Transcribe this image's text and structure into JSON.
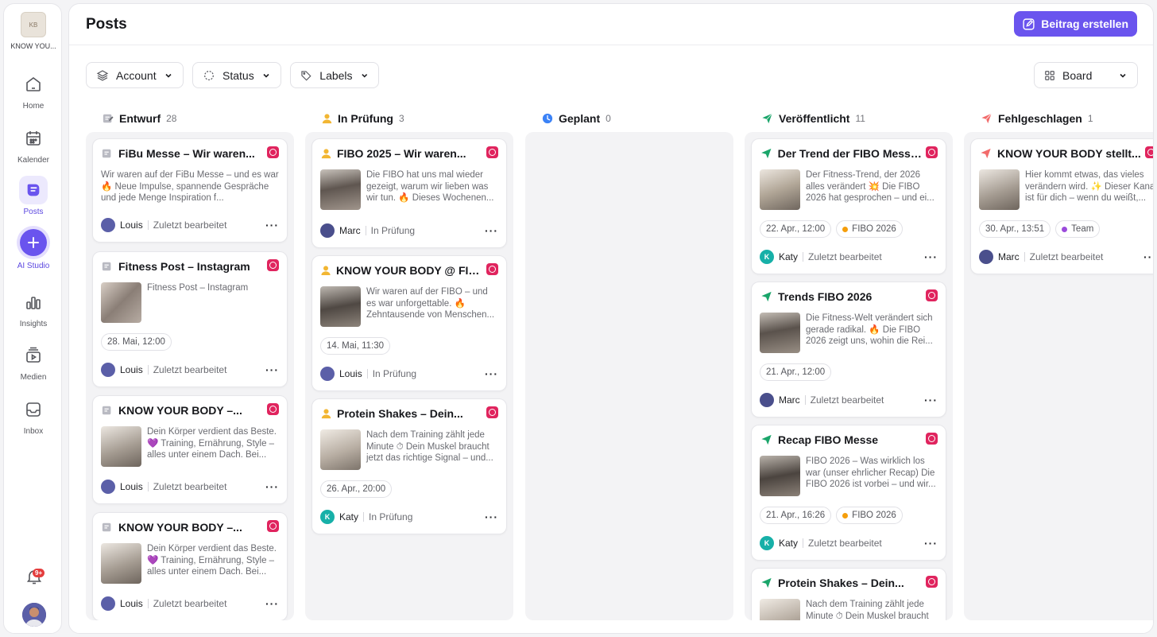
{
  "brand": {
    "name": "KNOW YOU...",
    "logo_text": "KB"
  },
  "nav": [
    {
      "label": "Home"
    },
    {
      "label": "Kalender"
    },
    {
      "label": "Posts"
    },
    {
      "label": "AI Studio"
    },
    {
      "label": "Insights"
    },
    {
      "label": "Medien"
    },
    {
      "label": "Inbox"
    }
  ],
  "notifications": {
    "badge": "9+"
  },
  "header": {
    "title": "Posts",
    "create_label": "Beitrag erstellen"
  },
  "filters": {
    "account": "Account",
    "status": "Status",
    "labels": "Labels",
    "view": "Board"
  },
  "colors": {
    "accent": "#6a54ee",
    "instagram": "#e0245e",
    "label_fibo": "#f59e0b",
    "label_team": "#9b4bdb"
  },
  "columns": [
    {
      "title": "Entwurf",
      "count": "28",
      "cards": [
        {
          "title": "FiBu Messe – Wir waren...",
          "text": "Wir waren auf der FiBu Messe – und es war 🔥 Neue Impulse, spannende Gespräche und jede Menge Inspiration f...",
          "user": "Louis",
          "status": "Zuletzt bearbeitet"
        },
        {
          "title": "Fitness Post – Instagram",
          "text": "Fitness Post – Instagram",
          "date": "28. Mai, 12:00",
          "user": "Louis",
          "status": "Zuletzt bearbeitet"
        },
        {
          "title": "KNOW YOUR BODY –...",
          "text": "Dein Körper verdient das Beste. 💜 Training, Ernährung, Style – alles unter einem Dach. Bei...",
          "user": "Louis",
          "status": "Zuletzt bearbeitet"
        },
        {
          "title": "KNOW YOUR BODY –...",
          "text": "Dein Körper verdient das Beste. 💜 Training, Ernährung, Style – alles unter einem Dach. Bei...",
          "user": "Louis",
          "status": "Zuletzt bearbeitet"
        }
      ]
    },
    {
      "title": "In Prüfung",
      "count": "3",
      "cards": [
        {
          "title": "FIBO 2025 – Wir waren...",
          "text": "Die FIBO hat uns mal wieder gezeigt, warum wir lieben was wir tun. 🔥 Dieses Wochenen...",
          "user": "Marc",
          "status": "In Prüfung"
        },
        {
          "title": "KNOW YOUR BODY @ FIBO...",
          "text": "Wir waren auf der FIBO – und es war unforgettable. 🔥 Zehntausende von Menschen...",
          "date": "14. Mai, 11:30",
          "user": "Louis",
          "status": "In Prüfung"
        },
        {
          "title": "Protein Shakes – Dein...",
          "text": "Nach dem Training zählt jede Minute ⏱ Dein Muskel braucht jetzt das richtige Signal – und...",
          "date": "26. Apr., 20:00",
          "user": "Katy",
          "status": "In Prüfung"
        }
      ]
    },
    {
      "title": "Geplant",
      "count": "0",
      "cards": []
    },
    {
      "title": "Veröffentlicht",
      "count": "11",
      "cards": [
        {
          "title": "Der Trend der FIBO Messe...",
          "text": "Der Fitness-Trend, der 2026 alles verändert 💥 Die FIBO 2026 hat gesprochen – und ei...",
          "date": "22. Apr., 12:00",
          "label": "FIBO 2026",
          "user": "Katy",
          "status": "Zuletzt bearbeitet"
        },
        {
          "title": "Trends FIBO 2026",
          "text": "Die Fitness-Welt verändert sich gerade radikal. 🔥 Die FIBO 2026 zeigt uns, wohin die Rei...",
          "date": "21. Apr., 12:00",
          "user": "Marc",
          "status": "Zuletzt bearbeitet"
        },
        {
          "title": "Recap FIBO Messe",
          "text": "FIBO 2026 – Was wirklich los war (unser ehrlicher Recap) Die FIBO 2026 ist vorbei – und wir...",
          "date": "21. Apr., 16:26",
          "label": "FIBO 2026",
          "user": "Katy",
          "status": "Zuletzt bearbeitet"
        },
        {
          "title": "Protein Shakes – Dein...",
          "text": "Nach dem Training zählt jede Minute ⏱ Dein Muskel braucht"
        }
      ]
    },
    {
      "title": "Fehlgeschlagen",
      "count": "1",
      "cards": [
        {
          "title": "KNOW YOUR BODY stellt...",
          "text": "Hier kommt etwas, das vieles verändern wird. ✨ Dieser Kanal ist für dich – wenn du weißt,...",
          "date": "30. Apr., 13:51",
          "label": "Team",
          "user": "Marc",
          "status": "Zuletzt bearbeitet"
        }
      ]
    }
  ]
}
